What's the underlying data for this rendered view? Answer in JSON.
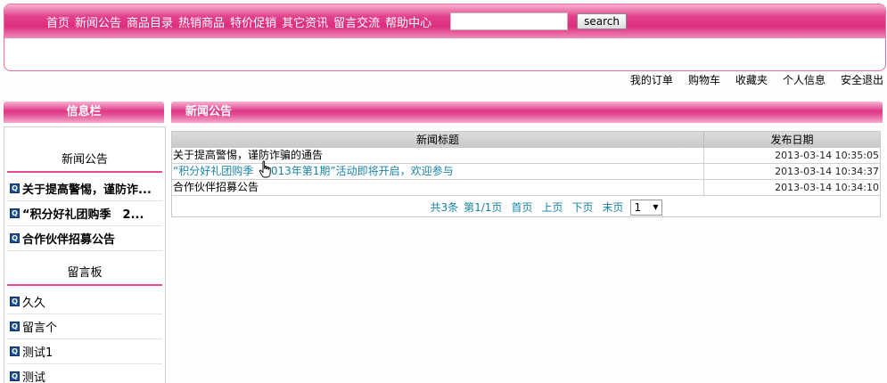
{
  "nav": {
    "items": [
      "首页",
      "新闻公告",
      "商品目录",
      "热销商品",
      "特价促销",
      "其它资讯",
      "留言交流",
      "帮助中心"
    ],
    "search_placeholder": "",
    "search_value": "",
    "search_label": "search"
  },
  "user_links": [
    "我的订单",
    "购物车",
    "收藏夹",
    "个人信息",
    "安全退出"
  ],
  "sidebar": {
    "title": "信息栏",
    "news_title": "新闻公告",
    "news_items": [
      "关于提高警惕，谨防诈...",
      "“积分好礼团购季　2...",
      "合作伙伴招募公告"
    ],
    "messages_title": "留言板",
    "message_items": [
      "久久",
      "留言个",
      "测试1",
      "测试"
    ]
  },
  "main": {
    "title": "新闻公告",
    "table": {
      "col_title": "新闻标题",
      "col_date": "发布日期",
      "rows": [
        {
          "title": "关于提高警惕，谨防诈骗的通告",
          "date": "2013-03-14 10:35:05"
        },
        {
          "title": "“积分好礼团购季　2013年第1期”活动即将开启，欢迎参与",
          "date": "2013-03-14 10:34:37"
        },
        {
          "title": "合作伙伴招募公告",
          "date": "2013-03-14 10:34:10"
        }
      ]
    },
    "pager": {
      "count": "共3条",
      "page": "第1/1页",
      "first": "首页",
      "prev": "上页",
      "next": "下页",
      "last": "末页",
      "selected": "1"
    }
  },
  "colors": {
    "accent": "#de3886",
    "link": "#1a84a8",
    "icon": "#1b4f9a"
  }
}
